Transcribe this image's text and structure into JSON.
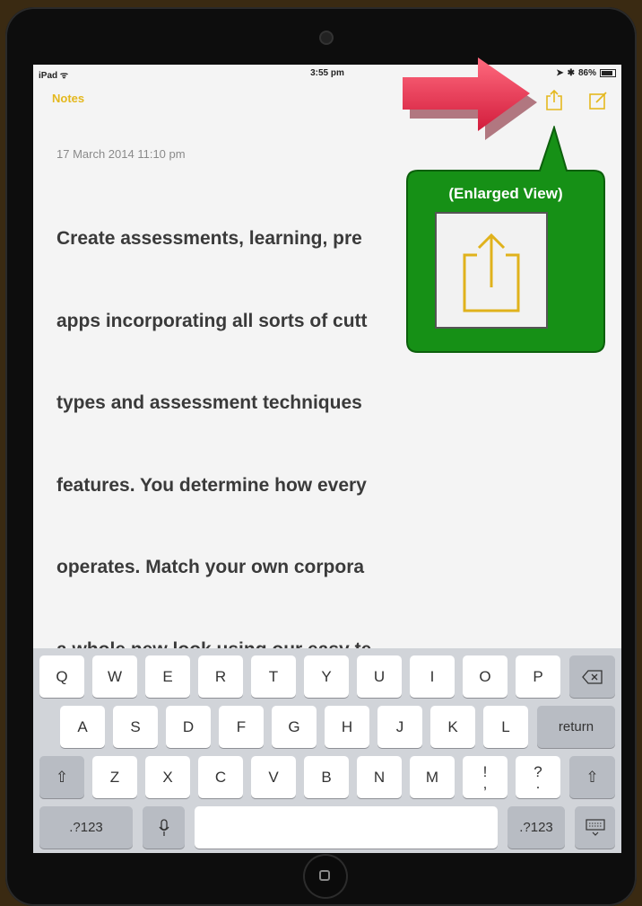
{
  "status": {
    "device": "iPad",
    "time": "3:55 pm",
    "battery": "86%"
  },
  "nav": {
    "back_label": "Notes"
  },
  "note": {
    "date": "17 March 2014 11:10 pm",
    "lines": [
      "Create assessments, learning, pre",
      "apps incorporating all sorts of cutt",
      "types and assessment techniques",
      "features. You determine how every",
      "operates. Match your own corpora",
      "a whole new look using our easy te"
    ]
  },
  "callout": {
    "title": "(Enlarged View)"
  },
  "keyboard": {
    "row1": [
      "Q",
      "W",
      "E",
      "R",
      "T",
      "Y",
      "U",
      "I",
      "O",
      "P"
    ],
    "row2": [
      "A",
      "S",
      "D",
      "F",
      "G",
      "H",
      "J",
      "K",
      "L"
    ],
    "row3": [
      "Z",
      "X",
      "C",
      "V",
      "B",
      "N",
      "M"
    ],
    "return_label": "return",
    "num_label": ".?123",
    "punct1": {
      "top": "!",
      "bottom": ","
    },
    "punct2": {
      "top": "?",
      "bottom": "."
    }
  },
  "colors": {
    "accent": "#e4b81e",
    "arrow": "#e8324f",
    "callout": "#1a8f1a"
  }
}
